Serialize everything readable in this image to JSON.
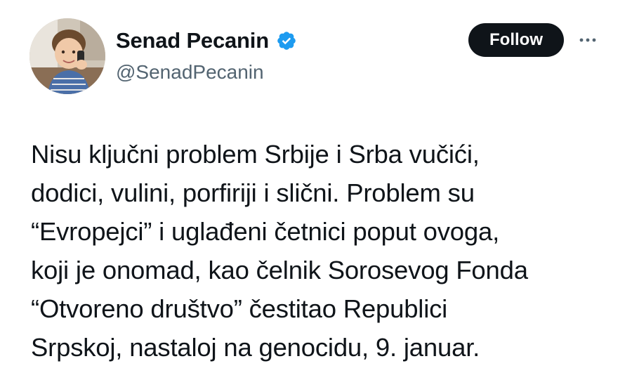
{
  "author": {
    "display_name": "Senad Pecanin",
    "handle": "@SenadPecanin",
    "verified": true,
    "avatar": "avatar-photo-child"
  },
  "actions": {
    "follow_label": "Follow",
    "more_icon": "more-horizontal-icon"
  },
  "tweet": {
    "text": "Nisu ključni problem Srbije i Srba vučići,\ndodici, vulini, porfiriji i slični. Problem su\n“Evropejci” i uglađeni četnici poput ovoga,\nkoji je onomad, kao čelnik Sorosevog Fonda\n“Otvoreno društvo” čestitao Republici\nSrpskoj, nastaloj na genocidu, 9. januar."
  },
  "colors": {
    "text_primary": "#0f1419",
    "text_secondary": "#536471",
    "verified_blue": "#1d9bf0",
    "follow_bg": "#0f1419",
    "follow_text": "#ffffff"
  }
}
